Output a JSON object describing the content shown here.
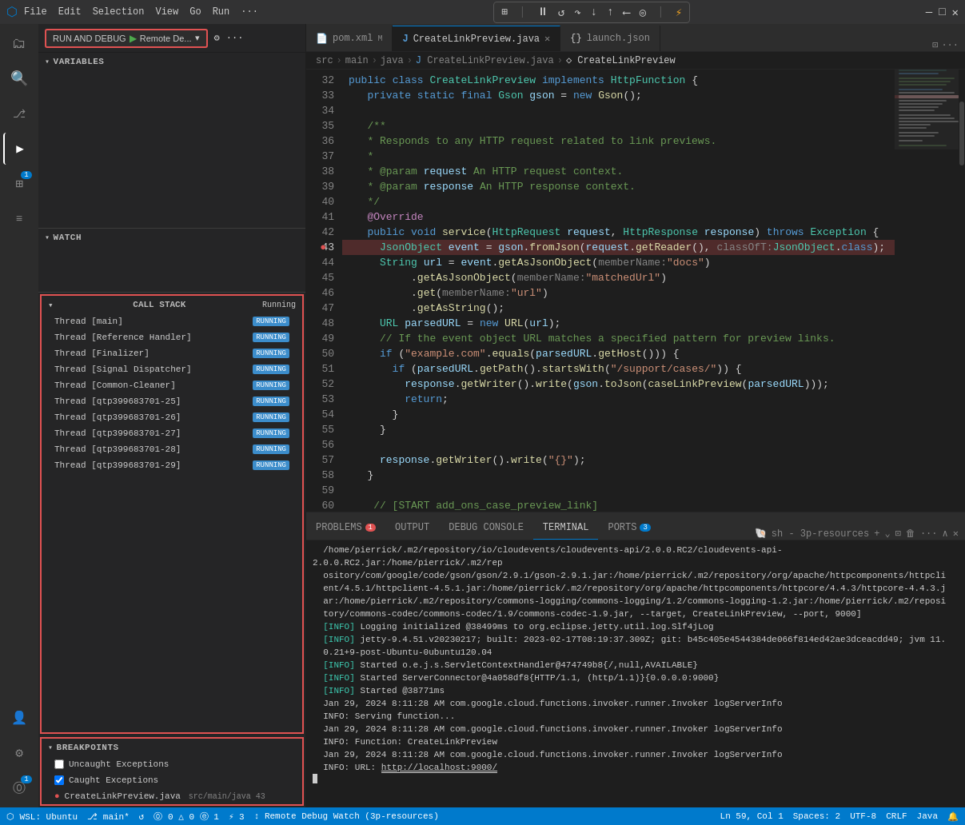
{
  "titleBar": {
    "appIcon": "⬡",
    "menus": [
      "File",
      "Edit",
      "Selection",
      "View",
      "Go",
      "Run",
      "···"
    ],
    "debugToolbar": {
      "items": [
        "⏸",
        "▶",
        "↺",
        "↓",
        "↑",
        "⟵",
        "◎",
        "⚡"
      ]
    },
    "windowControls": [
      "—",
      "□",
      "✕"
    ]
  },
  "runBar": {
    "runLabel": "RUN AND DEBUG",
    "playIcon": "▶",
    "configName": "Remote De...",
    "settingsIcon": "⚙",
    "moreIcon": "···"
  },
  "sidebar": {
    "variables": {
      "header": "VARIABLES"
    },
    "watch": {
      "header": "WATCH"
    },
    "callStack": {
      "header": "CALL STACK",
      "status": "Running",
      "threads": [
        {
          "name": "Thread [main]",
          "status": "RUNNING"
        },
        {
          "name": "Thread [Reference Handler]",
          "status": "RUNNING"
        },
        {
          "name": "Thread [Finalizer]",
          "status": "RUNNING"
        },
        {
          "name": "Thread [Signal Dispatcher]",
          "status": "RUNNING"
        },
        {
          "name": "Thread [Common-Cleaner]",
          "status": "RUNNING"
        },
        {
          "name": "Thread [qtp399683701-25]",
          "status": "RUNNING"
        },
        {
          "name": "Thread [qtp399683701-26]",
          "status": "RUNNING"
        },
        {
          "name": "Thread [qtp399683701-27]",
          "status": "RUNNING"
        },
        {
          "name": "Thread [qtp399683701-28]",
          "status": "RUNNING"
        },
        {
          "name": "Thread [qtp399683701-29]",
          "status": "RUNNING"
        }
      ]
    },
    "breakpoints": {
      "header": "BREAKPOINTS",
      "items": [
        {
          "checked": false,
          "type": "uncaught",
          "label": "Uncaught Exceptions"
        },
        {
          "checked": true,
          "type": "caught",
          "label": "Caught Exceptions"
        },
        {
          "dot": true,
          "file": "CreateLinkPreview.java",
          "path": "src/main/java",
          "line": "43"
        }
      ]
    }
  },
  "tabs": [
    {
      "id": "pom",
      "icon": "📄",
      "label": "pom.xml",
      "modified": true,
      "active": false
    },
    {
      "id": "java",
      "icon": "J",
      "label": "CreateLinkPreview.java",
      "active": true,
      "closeable": true
    },
    {
      "id": "launch",
      "icon": "{}",
      "label": "launch.json",
      "active": false
    }
  ],
  "breadcrumb": {
    "items": [
      "src",
      "main",
      "java",
      "J CreateLinkPreview.java",
      "◇ CreateLinkPreview"
    ]
  },
  "code": {
    "startLine": 32,
    "lines": [
      {
        "num": 32,
        "content": "public_class_CreateLinkPreview_implements_HttpFunction_{"
      },
      {
        "num": 33,
        "content": "_private_static_final_Gson_gson_=_new_Gson();"
      },
      {
        "num": 34,
        "content": ""
      },
      {
        "num": 35,
        "content": "_/**"
      },
      {
        "num": 36,
        "content": "_*_Responds_to_any_HTTP_request_related_to_link_previews."
      },
      {
        "num": 37,
        "content": "_*"
      },
      {
        "num": 38,
        "content": "_*_@param_request_An_HTTP_request_context."
      },
      {
        "num": 39,
        "content": "_*_@param_response_An_HTTP_response_context."
      },
      {
        "num": 40,
        "content": "_*/"
      },
      {
        "num": 41,
        "content": "_@Override"
      },
      {
        "num": 42,
        "content": "_public_void_service(HttpRequest_request,_HttpResponse_response)_throws_Exception_{"
      },
      {
        "num": 43,
        "content": "__JsonObject_event_=_gson.fromJson(request.getReader(),_classOfT:JsonObject.class);",
        "breakpoint": true
      },
      {
        "num": 44,
        "content": "__String_url_=_event.getAsJsonObject(memberName:\"docs\")"
      },
      {
        "num": 45,
        "content": "_____.getAsJsonObject(memberName:\"matchedUrl\")"
      },
      {
        "num": 46,
        "content": "_____.get(memberName:\"url\")"
      },
      {
        "num": 47,
        "content": "_____.getAsString();"
      },
      {
        "num": 48,
        "content": "__URL_parsedURL_=_new_URL(url);"
      },
      {
        "num": 49,
        "content": "__//_If_the_event_object_URL_matches_a_specified_pattern_for_preview_links."
      },
      {
        "num": 50,
        "content": "__if_(\"example.com\".equals(parsedURL.getHost()))_{"
      },
      {
        "num": 51,
        "content": "___if_(parsedURL.getPath().startsWith(\"/support/cases/\"))_{"
      },
      {
        "num": 52,
        "content": "____response.getWriter().write(gson.toJson(caseLinkPreview(parsedURL)));"
      },
      {
        "num": 53,
        "content": "____return;"
      },
      {
        "num": 54,
        "content": "___}"
      },
      {
        "num": 55,
        "content": "__}"
      },
      {
        "num": 56,
        "content": ""
      },
      {
        "num": 57,
        "content": "__response.getWriter().write(\"{}\");"
      },
      {
        "num": 58,
        "content": "_}"
      },
      {
        "num": 59,
        "content": ""
      },
      {
        "num": 60,
        "content": "__//[START_add_ons_case_preview_link]"
      }
    ]
  },
  "terminal": {
    "tabs": [
      {
        "label": "PROBLEMS",
        "badge": "1"
      },
      {
        "label": "OUTPUT"
      },
      {
        "label": "DEBUG CONSOLE"
      },
      {
        "label": "TERMINAL",
        "active": true
      },
      {
        "label": "PORTS",
        "badge": "3"
      }
    ],
    "shellInfo": "sh - 3p-resources",
    "content": [
      "  /home/pierrick/.m2/repository/io/cloudevents/cloudevents-api/2.0.0.RC2/cloudevents-api-2.0.0.RC2.jar:/home/pierrick/.m2/rep",
      "  ository/com/google/code/gson/gson/2.9.1/gson-2.9.1.jar:/home/pierrick/.m2/repository/org/apache/httpcomponents/httpcli",
      "  ent/4.5.1/httpclient-4.5.1.jar:/home/pierrick/.m2/repository/org/apache/httpcomponents/httpcore/4.4.3/httpcore-4.4.3.j",
      "  ar:/home/pierrick/.m2/repository/commons-logging/commons-logging/1.2/commons-logging-1.2.jar:/home/pierrick/.m2/reposi",
      "  tory/commons-codec/commons-codec/1.9/commons-codec-1.9.jar, --target, CreateLinkPreview, --port, 9000]",
      "  [INFO] Logging initialized @38499ms to org.eclipse.jetty.util.log.Slf4jLog",
      "  [INFO] jetty-9.4.51.v20230217; built: 2023-02-17T08:19:37.309Z; git: b45c405e4544384de066f814ed42ae3dceacdd49; jvm 11.",
      "  0.21+9-post-Ubuntu-0ubuntu120.04",
      "  [INFO] Started o.e.j.s.ServletContextHandler@474749b8{/,null,AVAILABLE}",
      "  [INFO] Started ServerConnector@4a058df8{HTTP/1.1, (http/1.1)}{0.0.0.0:9000}",
      "  [INFO] Started @38771ms",
      "  Jan 29, 2024 8:11:28 AM com.google.cloud.functions.invoker.runner.Invoker logServerInfo",
      "  INFO: Serving function...",
      "  Jan 29, 2024 8:11:28 AM com.google.cloud.functions.invoker.runner.Invoker logServerInfo",
      "  INFO: Function: CreateLinkPreview",
      "  Jan 29, 2024 8:11:28 AM com.google.cloud.functions.invoker.runner.Invoker logServerInfo",
      "  INFO: URL: http://localhost:9000/"
    ],
    "cursor": true
  },
  "statusBar": {
    "left": [
      "⎇ main*",
      "↺",
      "⓪ 0 △ 0 ⓔ 1",
      "⚡ 3"
    ],
    "right": [
      "↕ Remote Debug Watch (3p-resources)",
      "Ln 59, Col 1",
      "Spaces: 2",
      "UTF-8",
      "CRLF",
      "Java"
    ],
    "debugIcon": "🐛",
    "bellIcon": "🔔"
  },
  "activityBar": {
    "items": [
      {
        "id": "explorer",
        "icon": "⬜",
        "active": false
      },
      {
        "id": "search",
        "icon": "🔍",
        "active": false
      },
      {
        "id": "source-control",
        "icon": "⎇",
        "active": false
      },
      {
        "id": "debug",
        "icon": "▶",
        "active": true
      },
      {
        "id": "extensions",
        "icon": "⊞",
        "active": false
      },
      {
        "id": "remote",
        "icon": "≡",
        "active": false
      },
      {
        "id": "errors",
        "icon": "⚠",
        "badge": "1"
      }
    ]
  }
}
